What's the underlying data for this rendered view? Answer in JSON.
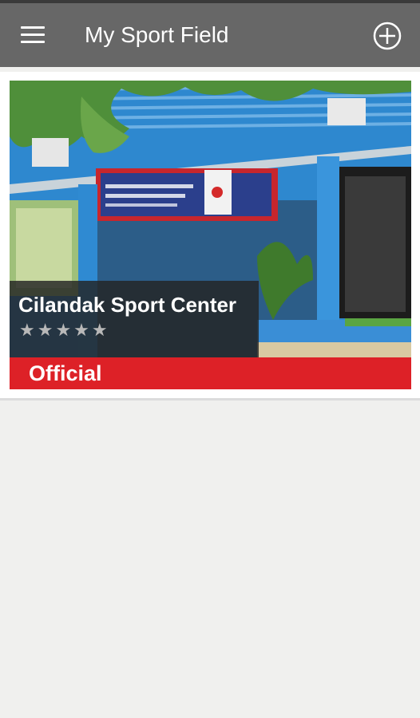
{
  "app_bar": {
    "title": "My Sport Field",
    "menu_icon": "hamburger-menu-icon",
    "add_icon": "add-circle-icon",
    "background_color": "#676767"
  },
  "fields": [
    {
      "name": "Cilandak Sport Center",
      "rating_stars": "★★★★★",
      "rating_value": 0,
      "rating_max": 5,
      "badge": "Official",
      "badge_color": "#dd2127"
    }
  ]
}
